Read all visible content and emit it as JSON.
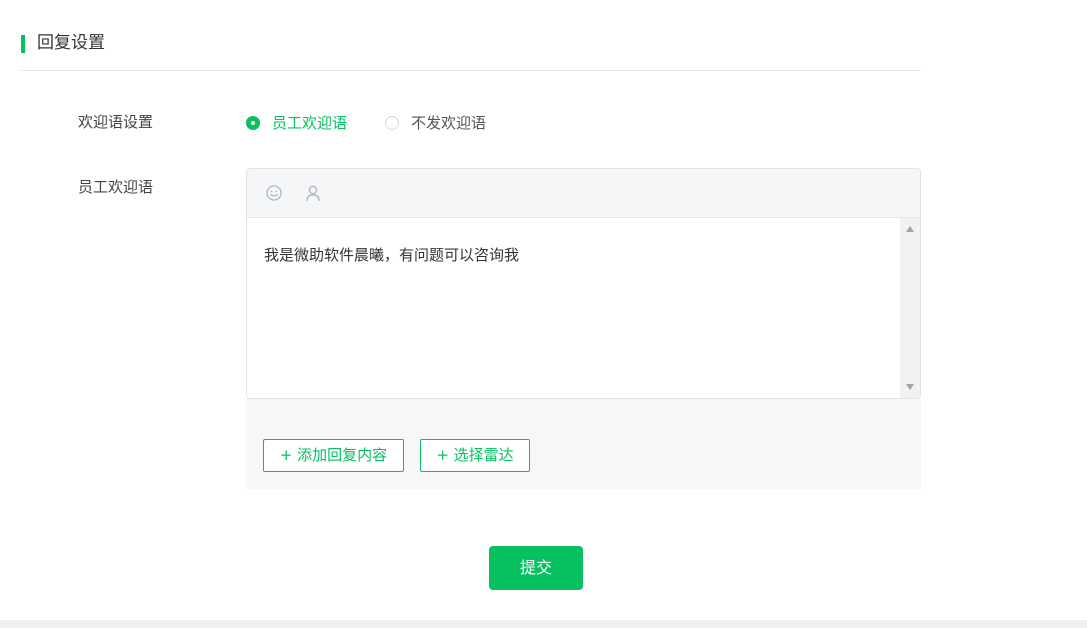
{
  "section": {
    "title": "回复设置"
  },
  "welcome_setting": {
    "label": "欢迎语设置",
    "options": [
      {
        "label": "员工欢迎语",
        "selected": true
      },
      {
        "label": "不发欢迎语",
        "selected": false
      }
    ]
  },
  "staff_welcome": {
    "label": "员工欢迎语",
    "toolbar_icons": [
      "emoji-icon",
      "user-icon"
    ],
    "message": "我是微助软件晨曦，有问题可以咨询我"
  },
  "actions": {
    "add_reply_label": "+ 添加回复内容",
    "select_radar_label": "+ 选择雷达",
    "submit_label": "提交"
  },
  "colors": {
    "accent": "#07c160",
    "panel_bg": "#f7f7f7",
    "toolbar_bg": "#f5f6f8"
  }
}
